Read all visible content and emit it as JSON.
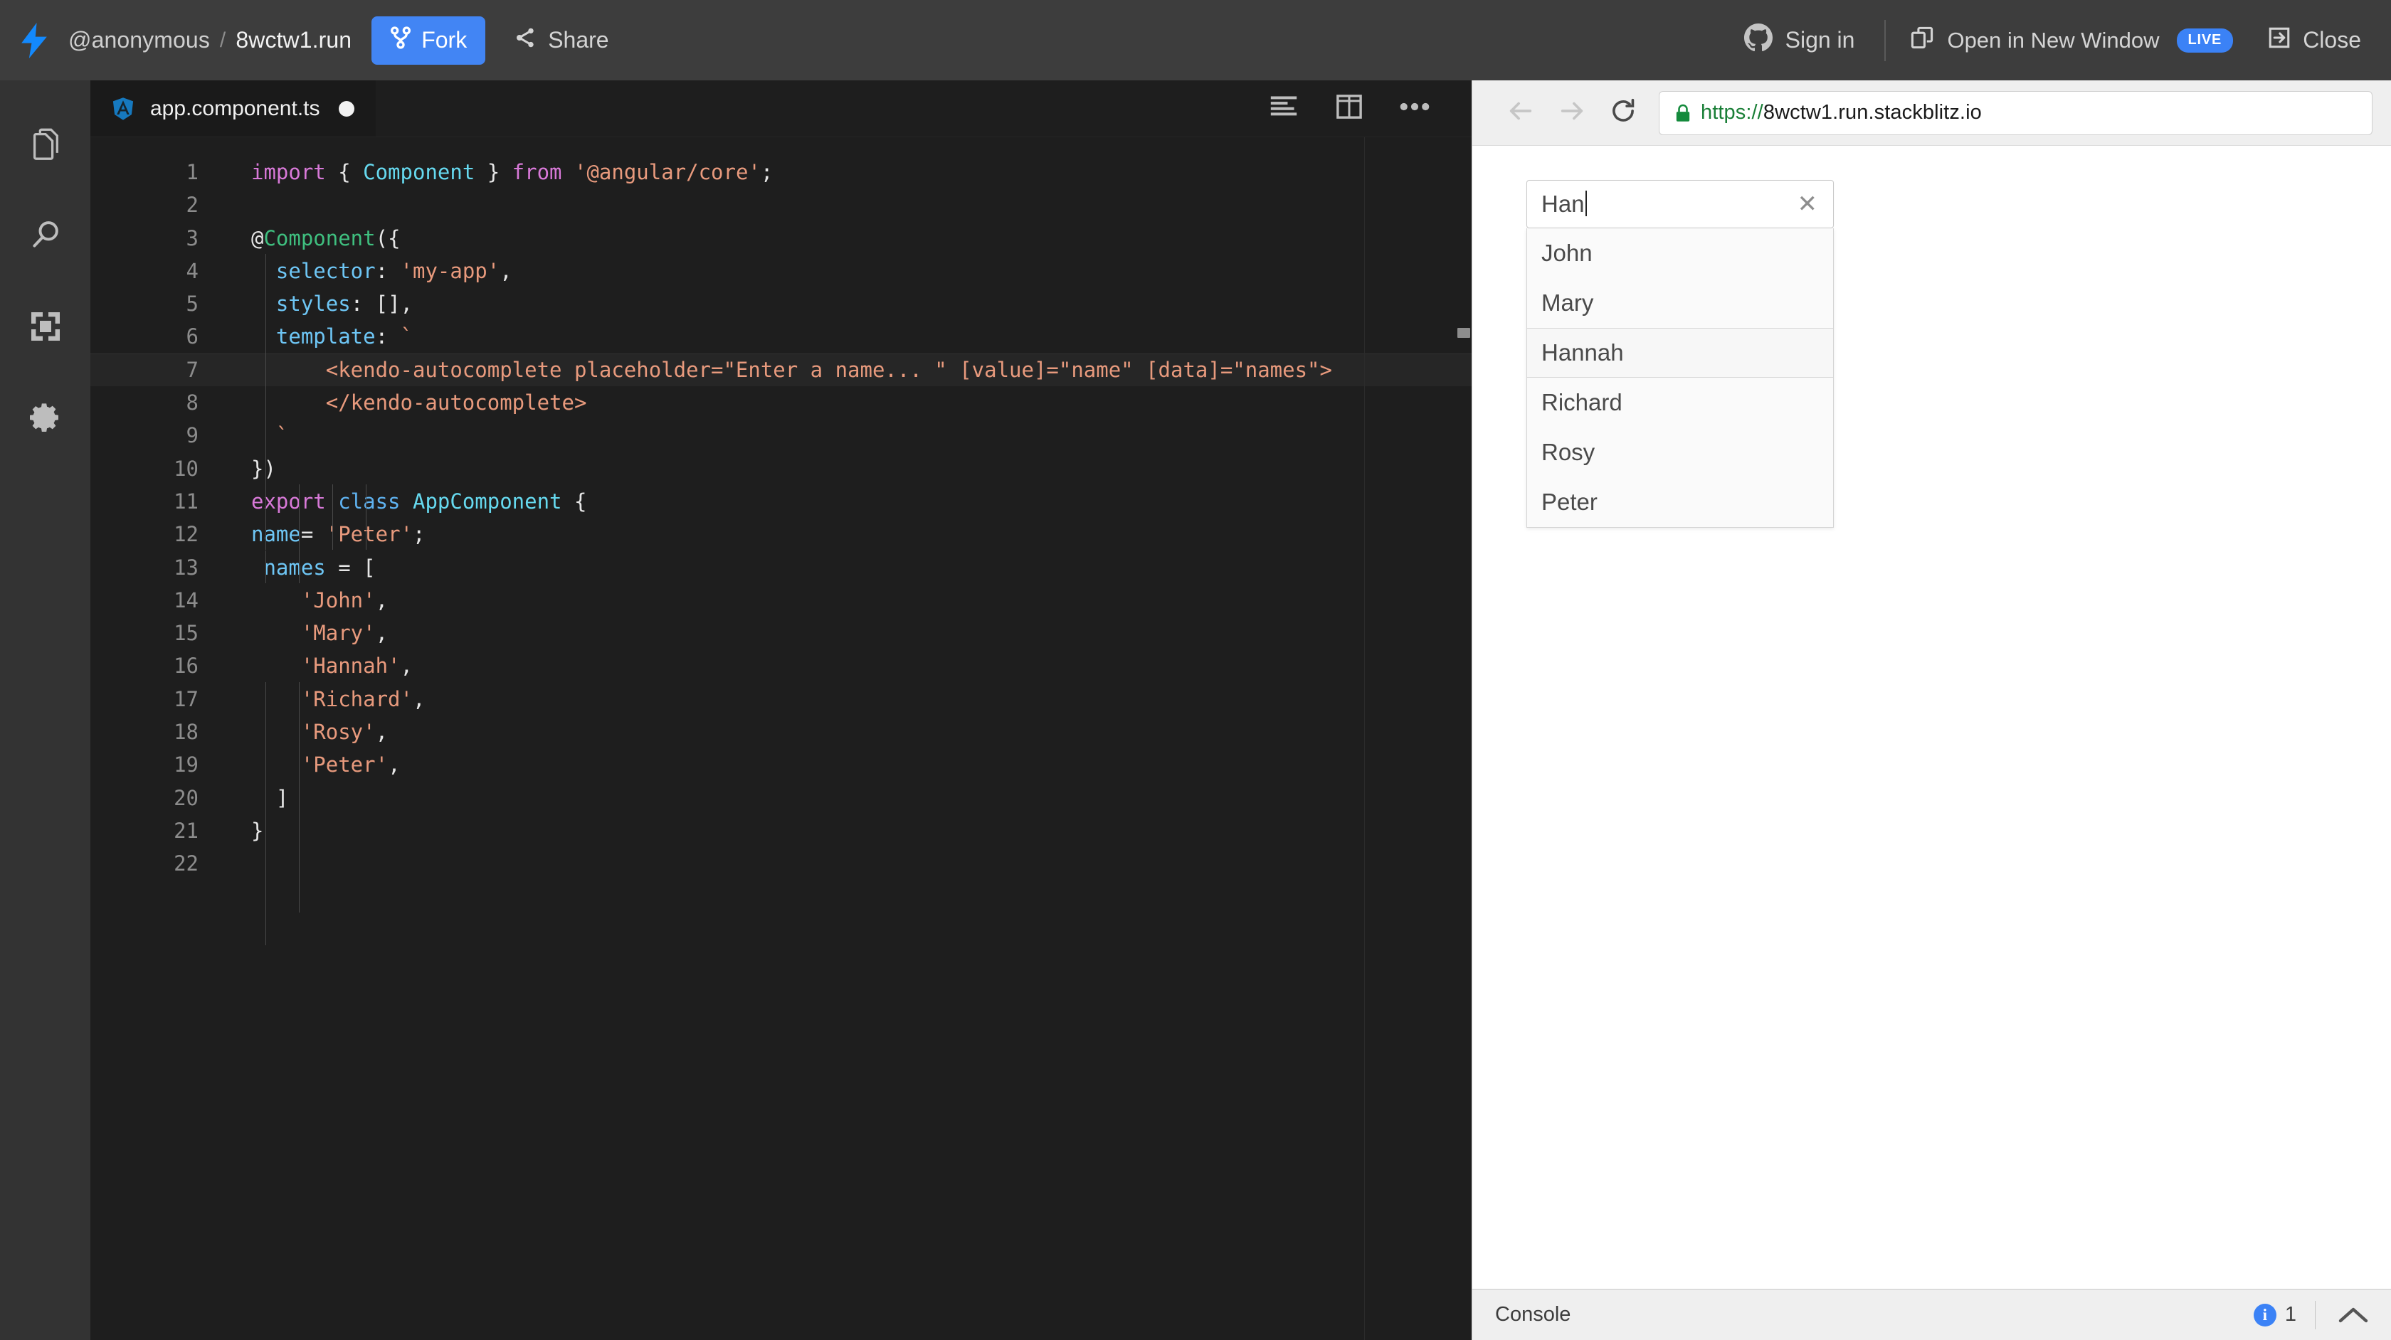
{
  "header": {
    "logo_icon": "lightning-bolt-icon",
    "user": "@anonymous",
    "separator": "/",
    "project": "8wctw1.run",
    "fork_label": "Fork",
    "share_label": "Share",
    "signin_label": "Sign in",
    "open_new_window_label": "Open in New Window",
    "live_badge": "LIVE",
    "close_label": "Close",
    "accent_blue": "#4285f4",
    "background": "#3d3d3d"
  },
  "sidebar": {
    "items": [
      {
        "name": "files",
        "icon": "files-icon"
      },
      {
        "name": "search",
        "icon": "search-icon"
      },
      {
        "name": "dependencies",
        "icon": "dependencies-icon"
      },
      {
        "name": "settings",
        "icon": "gear-icon"
      }
    ]
  },
  "editor": {
    "tab": {
      "icon": "angular-icon",
      "filename": "app.component.ts",
      "dirty": true
    },
    "actions": [
      {
        "name": "format-code",
        "icon": "format-lines-icon"
      },
      {
        "name": "split-editor",
        "icon": "split-panes-icon"
      },
      {
        "name": "more-options",
        "icon": "ellipsis-icon"
      }
    ],
    "active_line": 7,
    "background": "#1e1e1e",
    "lines": [
      {
        "n": 1,
        "tokens": [
          {
            "t": "import ",
            "c": "kw"
          },
          {
            "t": "{ ",
            "c": "punc"
          },
          {
            "t": "Component",
            "c": "type"
          },
          {
            "t": " } ",
            "c": "punc"
          },
          {
            "t": "from ",
            "c": "kw"
          },
          {
            "t": "'@angular/core'",
            "c": "str"
          },
          {
            "t": ";",
            "c": "punc"
          }
        ]
      },
      {
        "n": 2,
        "tokens": []
      },
      {
        "n": 3,
        "tokens": [
          {
            "t": "@",
            "c": "punc"
          },
          {
            "t": "Component",
            "c": "deco"
          },
          {
            "t": "({",
            "c": "punc"
          }
        ]
      },
      {
        "n": 4,
        "tokens": [
          {
            "t": "  ",
            "c": "punc"
          },
          {
            "t": "selector",
            "c": "prop"
          },
          {
            "t": ": ",
            "c": "punc"
          },
          {
            "t": "'my-app'",
            "c": "str"
          },
          {
            "t": ",",
            "c": "punc"
          }
        ]
      },
      {
        "n": 5,
        "tokens": [
          {
            "t": "  ",
            "c": "punc"
          },
          {
            "t": "styles",
            "c": "prop"
          },
          {
            "t": ": [],",
            "c": "punc"
          }
        ]
      },
      {
        "n": 6,
        "tokens": [
          {
            "t": "  ",
            "c": "punc"
          },
          {
            "t": "template",
            "c": "prop"
          },
          {
            "t": ": ",
            "c": "punc"
          },
          {
            "t": "`",
            "c": "str"
          }
        ]
      },
      {
        "n": 7,
        "tokens": [
          {
            "t": "      <kendo-autocomplete placeholder=\"Enter a name... \" [value]=\"name\" [data]=\"names\">",
            "c": "str"
          }
        ]
      },
      {
        "n": 8,
        "tokens": [
          {
            "t": "      </kendo-autocomplete>",
            "c": "str"
          }
        ]
      },
      {
        "n": 9,
        "tokens": [
          {
            "t": "  `",
            "c": "str"
          }
        ]
      },
      {
        "n": 10,
        "tokens": [
          {
            "t": "})",
            "c": "punc"
          }
        ]
      },
      {
        "n": 11,
        "tokens": [
          {
            "t": "export ",
            "c": "kw"
          },
          {
            "t": "class ",
            "c": "kw2"
          },
          {
            "t": "AppComponent",
            "c": "type"
          },
          {
            "t": " {",
            "c": "punc"
          }
        ]
      },
      {
        "n": 12,
        "tokens": [
          {
            "t": "name",
            "c": "prop"
          },
          {
            "t": "= ",
            "c": "punc"
          },
          {
            "t": "'Peter'",
            "c": "str"
          },
          {
            "t": ";",
            "c": "punc"
          }
        ]
      },
      {
        "n": 13,
        "tokens": [
          {
            "t": " ",
            "c": "punc"
          },
          {
            "t": "names",
            "c": "prop"
          },
          {
            "t": " = [",
            "c": "punc"
          }
        ]
      },
      {
        "n": 14,
        "tokens": [
          {
            "t": "    ",
            "c": "punc"
          },
          {
            "t": "'John'",
            "c": "str"
          },
          {
            "t": ",",
            "c": "punc"
          }
        ]
      },
      {
        "n": 15,
        "tokens": [
          {
            "t": "    ",
            "c": "punc"
          },
          {
            "t": "'Mary'",
            "c": "str"
          },
          {
            "t": ",",
            "c": "punc"
          }
        ]
      },
      {
        "n": 16,
        "tokens": [
          {
            "t": "    ",
            "c": "punc"
          },
          {
            "t": "'Hannah'",
            "c": "str"
          },
          {
            "t": ",",
            "c": "punc"
          }
        ]
      },
      {
        "n": 17,
        "tokens": [
          {
            "t": "    ",
            "c": "punc"
          },
          {
            "t": "'Richard'",
            "c": "str"
          },
          {
            "t": ",",
            "c": "punc"
          }
        ]
      },
      {
        "n": 18,
        "tokens": [
          {
            "t": "    ",
            "c": "punc"
          },
          {
            "t": "'Rosy'",
            "c": "str"
          },
          {
            "t": ",",
            "c": "punc"
          }
        ]
      },
      {
        "n": 19,
        "tokens": [
          {
            "t": "    ",
            "c": "punc"
          },
          {
            "t": "'Peter'",
            "c": "str"
          },
          {
            "t": ",",
            "c": "punc"
          }
        ]
      },
      {
        "n": 20,
        "tokens": [
          {
            "t": "  ]",
            "c": "punc"
          }
        ]
      },
      {
        "n": 21,
        "tokens": [
          {
            "t": "}",
            "c": "punc"
          }
        ]
      },
      {
        "n": 22,
        "tokens": []
      }
    ]
  },
  "preview": {
    "nav": {
      "back_icon": "arrow-left-icon",
      "forward_icon": "arrow-right-icon",
      "reload_icon": "reload-icon"
    },
    "address": {
      "lock_icon": "lock-icon",
      "scheme": "https://",
      "host": "8wctw1.run.stackblitz.io"
    },
    "autocomplete": {
      "value": "Han",
      "placeholder": "Enter a name... ",
      "clear_icon": "clear-x-icon",
      "items": [
        "John",
        "Mary",
        "Hannah",
        "Richard",
        "Rosy",
        "Peter"
      ],
      "selected": "Hannah"
    },
    "console": {
      "label": "Console",
      "info_icon": "info-icon",
      "info_count": "1",
      "collapse_icon": "chevron-up-icon"
    }
  }
}
